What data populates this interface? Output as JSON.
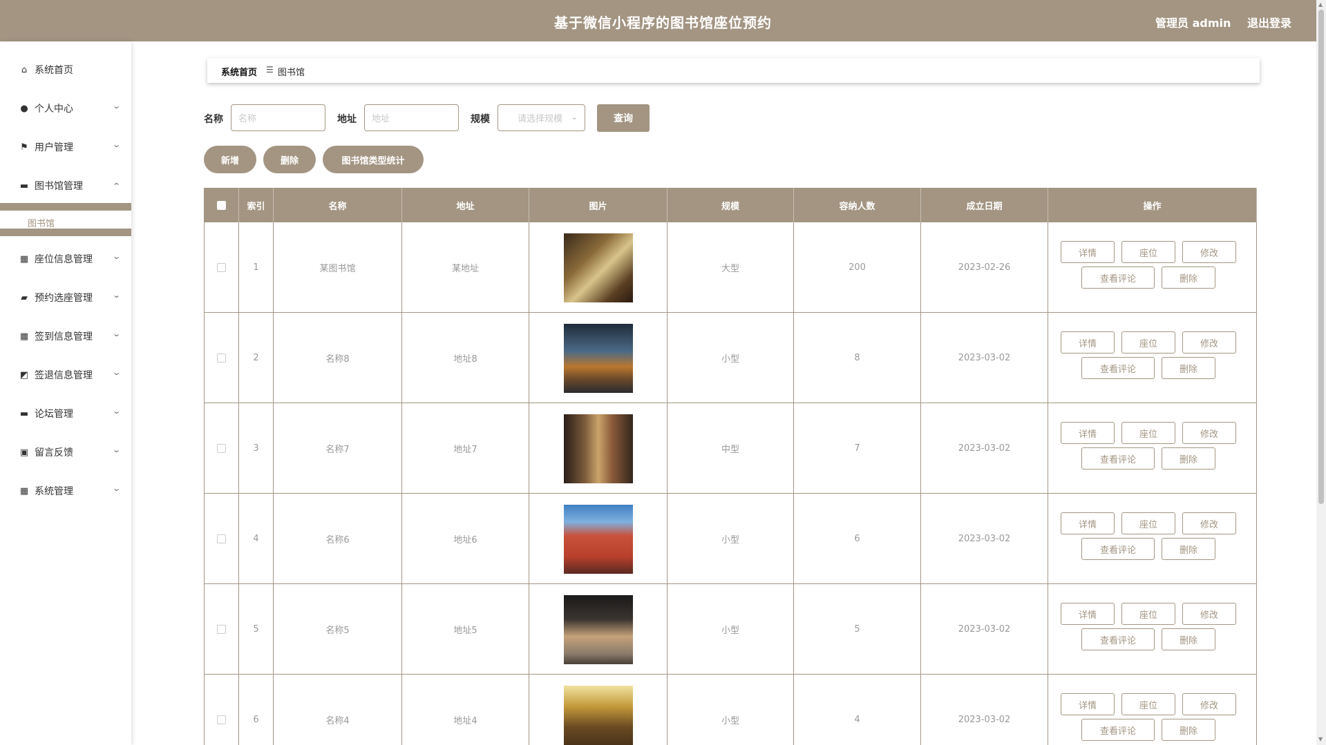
{
  "header": {
    "title": "基于微信小程序的图书馆座位预约",
    "admin_label": "管理员 admin",
    "logout_label": "退出登录"
  },
  "sidebar": {
    "items": [
      {
        "label": "系统首页",
        "icon": "home-icon",
        "glyph": "⌂",
        "has_arrow": false
      },
      {
        "label": "个人中心",
        "icon": "user-icon",
        "glyph": "●",
        "has_arrow": true
      },
      {
        "label": "用户管理",
        "icon": "flag-icon",
        "glyph": "⚑",
        "has_arrow": true
      },
      {
        "label": "图书馆管理",
        "icon": "chat-icon",
        "glyph": "▬",
        "has_arrow": true,
        "expanded": true
      },
      {
        "label": "座位信息管理",
        "icon": "grid-icon",
        "glyph": "▦",
        "has_arrow": true
      },
      {
        "label": "预约选座管理",
        "icon": "wallet-icon",
        "glyph": "▰",
        "has_arrow": true
      },
      {
        "label": "签到信息管理",
        "icon": "grid-icon",
        "glyph": "▦",
        "has_arrow": true
      },
      {
        "label": "签退信息管理",
        "icon": "chart-icon",
        "glyph": "◩",
        "has_arrow": true
      },
      {
        "label": "论坛管理",
        "icon": "forum-icon",
        "glyph": "▬",
        "has_arrow": true
      },
      {
        "label": "留言反馈",
        "icon": "briefcase-icon",
        "glyph": "▣",
        "has_arrow": true
      },
      {
        "label": "系统管理",
        "icon": "grid-icon",
        "glyph": "▦",
        "has_arrow": true
      }
    ],
    "submenu": {
      "label": "图书馆"
    }
  },
  "breadcrumb": {
    "home": "系统首页",
    "separator_icon": "menu-icon",
    "separator": "☰",
    "current": "图书馆"
  },
  "filters": {
    "name_label": "名称",
    "name_placeholder": "名称",
    "address_label": "地址",
    "address_placeholder": "地址",
    "scale_label": "规模",
    "scale_placeholder": "请选择规模",
    "query_button": "查询"
  },
  "actions": {
    "add": "新增",
    "delete": "删除",
    "stats": "图书馆类型统计"
  },
  "table": {
    "columns": [
      "",
      "索引",
      "名称",
      "地址",
      "图片",
      "规模",
      "容纳人数",
      "成立日期",
      "操作"
    ],
    "rows": [
      {
        "index": "1",
        "name": "某图书馆",
        "address": "某地址",
        "scale": "大型",
        "capacity": "200",
        "date": "2023-02-26"
      },
      {
        "index": "2",
        "name": "名称8",
        "address": "地址8",
        "scale": "小型",
        "capacity": "8",
        "date": "2023-03-02"
      },
      {
        "index": "3",
        "name": "名称7",
        "address": "地址7",
        "scale": "中型",
        "capacity": "7",
        "date": "2023-03-02"
      },
      {
        "index": "4",
        "name": "名称6",
        "address": "地址6",
        "scale": "小型",
        "capacity": "6",
        "date": "2023-03-02"
      },
      {
        "index": "5",
        "name": "名称5",
        "address": "地址5",
        "scale": "小型",
        "capacity": "5",
        "date": "2023-03-02"
      },
      {
        "index": "6",
        "name": "名称4",
        "address": "地址4",
        "scale": "小型",
        "capacity": "4",
        "date": "2023-03-02"
      }
    ],
    "row_buttons": {
      "detail": "详情",
      "seat": "座位",
      "edit": "修改",
      "comments": "查看评论",
      "delete": "删除"
    }
  },
  "colors": {
    "accent": "#a39582",
    "white": "#ffffff"
  }
}
